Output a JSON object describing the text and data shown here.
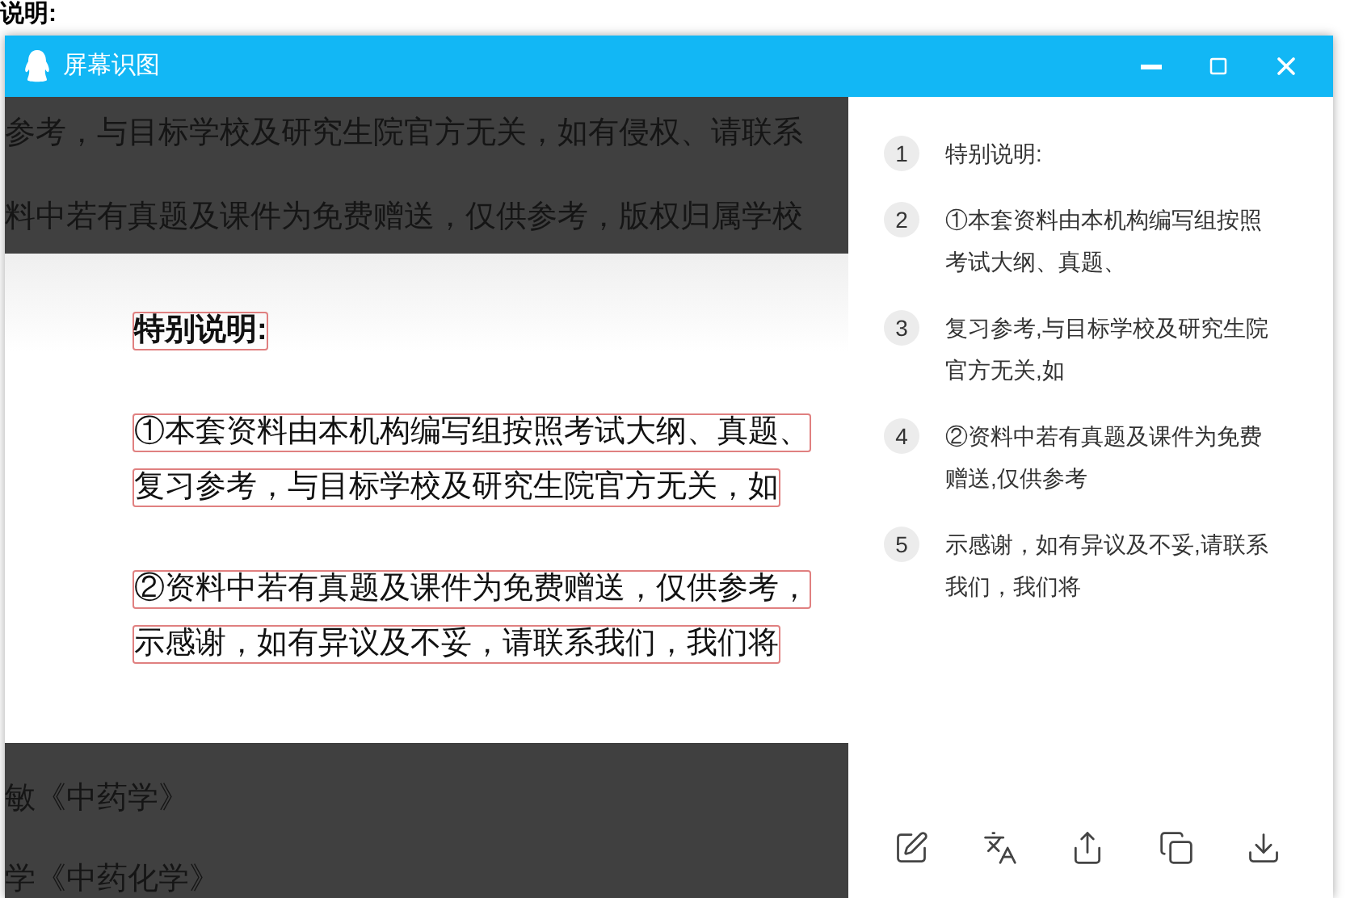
{
  "background_doc": {
    "heading": "说明:"
  },
  "window": {
    "title": "屏幕识图",
    "screenshot": {
      "dim_lines_top": [
        "参考，与目标学校及研究生院官方无关，如有侵权、请联系",
        "料中若有真题及课件为免费赠送，仅供参考，版权归属学校"
      ],
      "selection_paragraphs": [
        {
          "bold": true,
          "lines": [
            "特别说明:"
          ]
        },
        {
          "bold": false,
          "lines": [
            "①本套资料由本机构编写组按照考试大纲、真题、",
            "复习参考，与目标学校及研究生院官方无关，如"
          ]
        },
        {
          "bold": false,
          "lines": [
            "②资料中若有真题及课件为免费赠送，仅供参考，",
            "示感谢，如有异议及不妥，请联系我们，我们将"
          ]
        }
      ],
      "dim_lines_bottom": [
        "敏《中药学》",
        "学《中药化学》"
      ]
    },
    "results": [
      {
        "number": "1",
        "text": "特别说明:"
      },
      {
        "number": "2",
        "text": "①本套资料由本机构编写组按照考试大纲、真题、"
      },
      {
        "number": "3",
        "text": "复习参考,与目标学校及研究生院官方无关,如"
      },
      {
        "number": "4",
        "text": "②资料中若有真题及课件为免费赠送,仅供参考"
      },
      {
        "number": "5",
        "text": "示感谢，如有异议及不妥,请联系我们，我们将"
      }
    ],
    "toolbar": [
      {
        "kind": "edit"
      },
      {
        "kind": "translate"
      },
      {
        "kind": "share"
      },
      {
        "kind": "copy"
      },
      {
        "kind": "download"
      }
    ]
  }
}
